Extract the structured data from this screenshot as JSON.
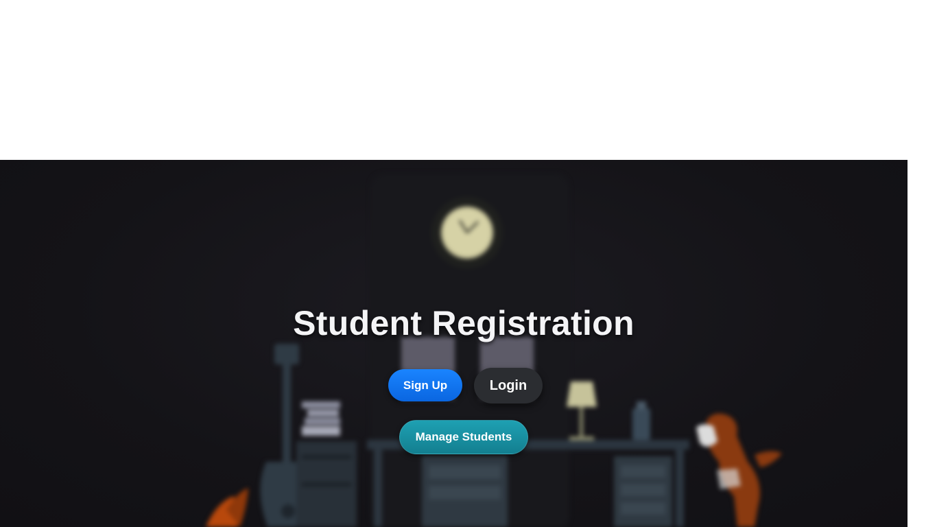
{
  "hero": {
    "title": "Student Registration"
  },
  "actions": {
    "signup_label": "Sign Up",
    "login_label": "Login",
    "manage_label": "Manage Students"
  },
  "colors": {
    "signup": "#0a6fee",
    "login": "#2b2d31",
    "manage": "#178fa1",
    "background": "#141317"
  },
  "background_icons": [
    "wall-clock-icon",
    "desk-lamp-icon",
    "guitar-icon",
    "bookshelf-icon",
    "cabinet-icon",
    "dog-icon",
    "plant-icon"
  ]
}
